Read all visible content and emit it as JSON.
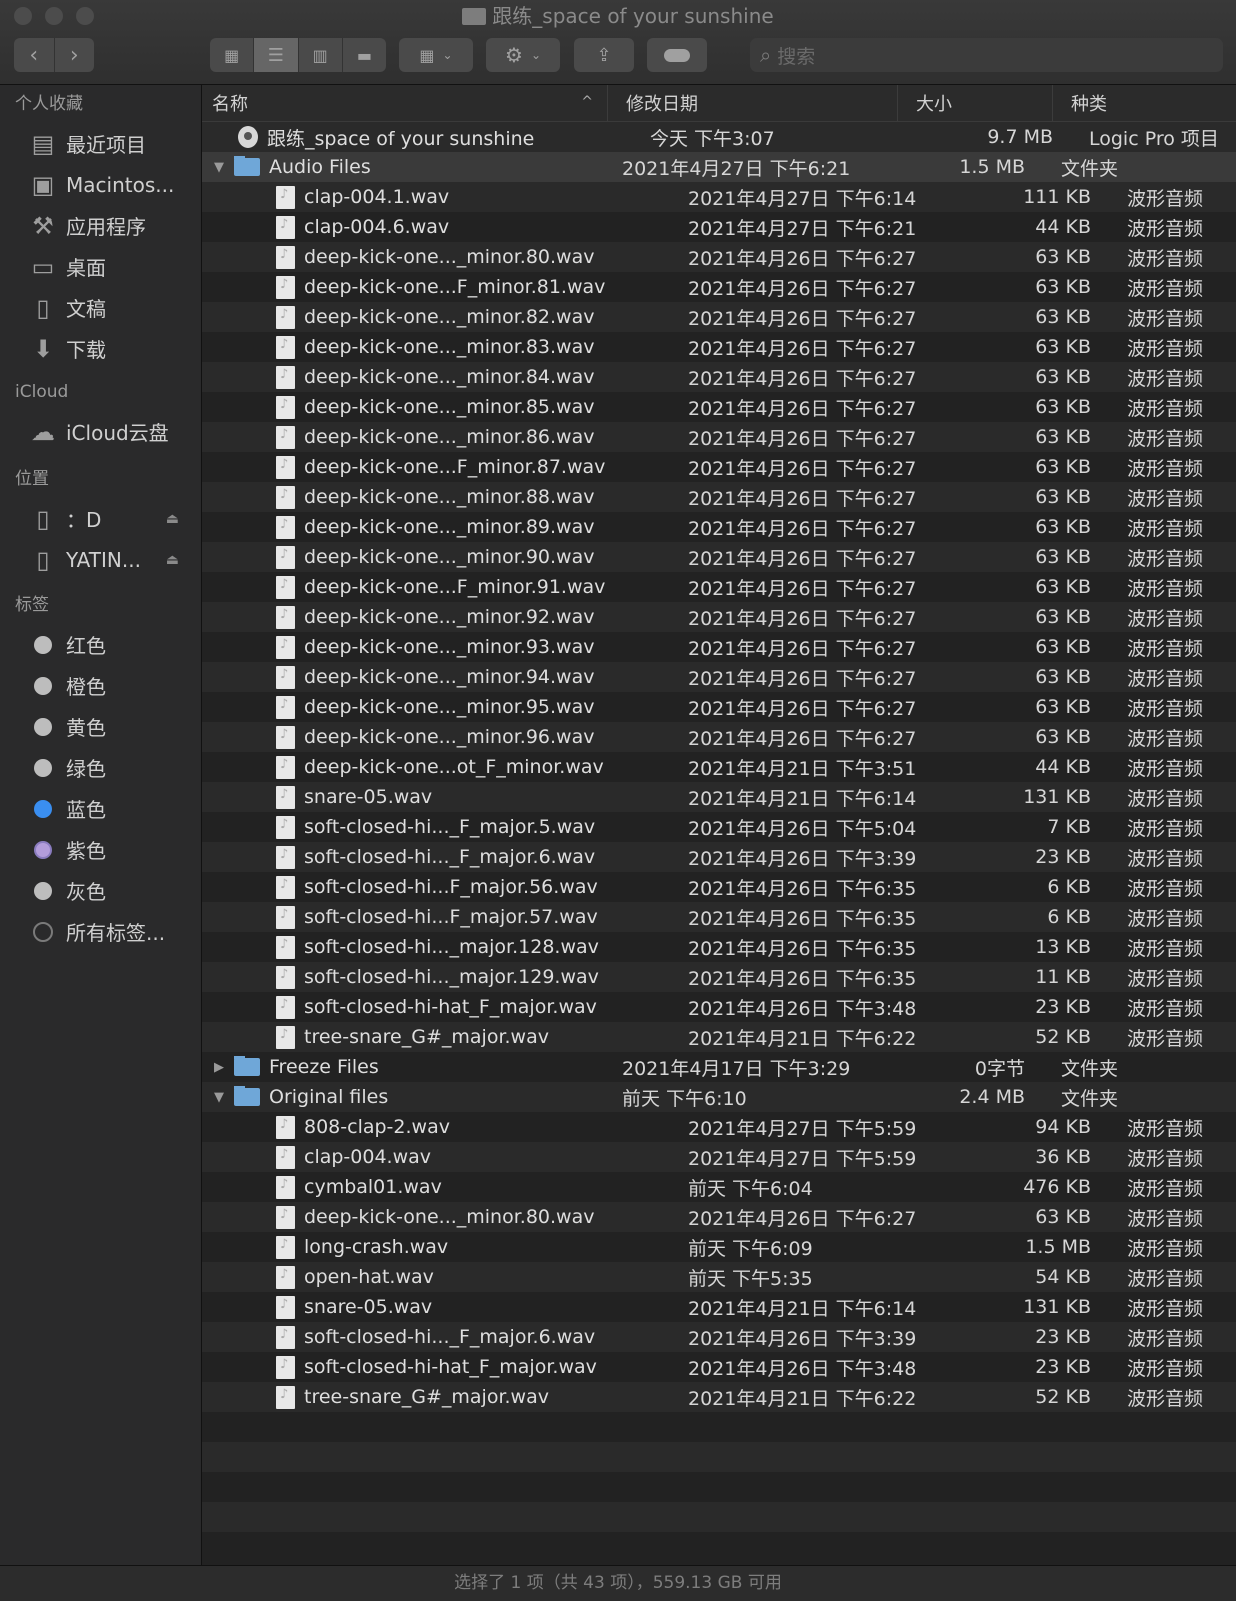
{
  "window": {
    "title": "跟练_space of your sunshine"
  },
  "toolbar": {
    "search_placeholder": "搜索"
  },
  "sidebar": {
    "favorites_header": "个人收藏",
    "favorites": [
      {
        "label": "最近项目",
        "icon": "recents-icon"
      },
      {
        "label": "Macintos...",
        "icon": "hard-drive-icon"
      },
      {
        "label": "应用程序",
        "icon": "applications-icon"
      },
      {
        "label": "桌面",
        "icon": "desktop-icon"
      },
      {
        "label": "文稿",
        "icon": "documents-icon"
      },
      {
        "label": "下载",
        "icon": "downloads-icon"
      }
    ],
    "icloud_header": "iCloud",
    "icloud": [
      {
        "label": "iCloud云盘",
        "icon": "cloud-icon"
      }
    ],
    "locations_header": "位置",
    "locations": [
      {
        "label": "：D",
        "icon": "phone-icon"
      },
      {
        "label": "YATIN...",
        "icon": "phone-icon"
      }
    ],
    "tags_header": "标签",
    "tags": [
      {
        "label": "红色",
        "color": "#bdbdbd"
      },
      {
        "label": "橙色",
        "color": "#bdbdbd"
      },
      {
        "label": "黄色",
        "color": "#bdbdbd"
      },
      {
        "label": "绿色",
        "color": "#bdbdbd"
      },
      {
        "label": "蓝色",
        "color": "#3a8ef0"
      },
      {
        "label": "紫色",
        "color": "#b39ddb"
      },
      {
        "label": "灰色",
        "color": "#bdbdbd"
      },
      {
        "label": "所有标签...",
        "color": "none"
      }
    ]
  },
  "columns": {
    "name": "名称",
    "date": "修改日期",
    "size": "大小",
    "kind": "种类"
  },
  "rows": [
    {
      "name": "跟练_space of your sunshine",
      "date": "今天 下午3:07",
      "size": "9.7 MB",
      "kind": "Logic Pro 项目",
      "type": "logic",
      "level": 0
    },
    {
      "name": "Audio Files",
      "date": "2021年4月27日 下午6:21",
      "size": "1.5 MB",
      "kind": "文件夹",
      "type": "folder",
      "level": 0,
      "expanded": true,
      "selected": true
    },
    {
      "name": "clap-004.1.wav",
      "date": "2021年4月27日 下午6:14",
      "size": "111 KB",
      "kind": "波形音频",
      "type": "audio",
      "level": 1
    },
    {
      "name": "clap-004.6.wav",
      "date": "2021年4月27日 下午6:21",
      "size": "44 KB",
      "kind": "波形音频",
      "type": "audio",
      "level": 1
    },
    {
      "name": "deep-kick-one..._minor.80.wav",
      "date": "2021年4月26日 下午6:27",
      "size": "63 KB",
      "kind": "波形音频",
      "type": "audio",
      "level": 1
    },
    {
      "name": "deep-kick-one...F_minor.81.wav",
      "date": "2021年4月26日 下午6:27",
      "size": "63 KB",
      "kind": "波形音频",
      "type": "audio",
      "level": 1
    },
    {
      "name": "deep-kick-one..._minor.82.wav",
      "date": "2021年4月26日 下午6:27",
      "size": "63 KB",
      "kind": "波形音频",
      "type": "audio",
      "level": 1
    },
    {
      "name": "deep-kick-one..._minor.83.wav",
      "date": "2021年4月26日 下午6:27",
      "size": "63 KB",
      "kind": "波形音频",
      "type": "audio",
      "level": 1
    },
    {
      "name": "deep-kick-one..._minor.84.wav",
      "date": "2021年4月26日 下午6:27",
      "size": "63 KB",
      "kind": "波形音频",
      "type": "audio",
      "level": 1
    },
    {
      "name": "deep-kick-one..._minor.85.wav",
      "date": "2021年4月26日 下午6:27",
      "size": "63 KB",
      "kind": "波形音频",
      "type": "audio",
      "level": 1
    },
    {
      "name": "deep-kick-one..._minor.86.wav",
      "date": "2021年4月26日 下午6:27",
      "size": "63 KB",
      "kind": "波形音频",
      "type": "audio",
      "level": 1
    },
    {
      "name": "deep-kick-one...F_minor.87.wav",
      "date": "2021年4月26日 下午6:27",
      "size": "63 KB",
      "kind": "波形音频",
      "type": "audio",
      "level": 1
    },
    {
      "name": "deep-kick-one..._minor.88.wav",
      "date": "2021年4月26日 下午6:27",
      "size": "63 KB",
      "kind": "波形音频",
      "type": "audio",
      "level": 1
    },
    {
      "name": "deep-kick-one..._minor.89.wav",
      "date": "2021年4月26日 下午6:27",
      "size": "63 KB",
      "kind": "波形音频",
      "type": "audio",
      "level": 1
    },
    {
      "name": "deep-kick-one..._minor.90.wav",
      "date": "2021年4月26日 下午6:27",
      "size": "63 KB",
      "kind": "波形音频",
      "type": "audio",
      "level": 1
    },
    {
      "name": "deep-kick-one...F_minor.91.wav",
      "date": "2021年4月26日 下午6:27",
      "size": "63 KB",
      "kind": "波形音频",
      "type": "audio",
      "level": 1
    },
    {
      "name": "deep-kick-one..._minor.92.wav",
      "date": "2021年4月26日 下午6:27",
      "size": "63 KB",
      "kind": "波形音频",
      "type": "audio",
      "level": 1
    },
    {
      "name": "deep-kick-one..._minor.93.wav",
      "date": "2021年4月26日 下午6:27",
      "size": "63 KB",
      "kind": "波形音频",
      "type": "audio",
      "level": 1
    },
    {
      "name": "deep-kick-one..._minor.94.wav",
      "date": "2021年4月26日 下午6:27",
      "size": "63 KB",
      "kind": "波形音频",
      "type": "audio",
      "level": 1
    },
    {
      "name": "deep-kick-one..._minor.95.wav",
      "date": "2021年4月26日 下午6:27",
      "size": "63 KB",
      "kind": "波形音频",
      "type": "audio",
      "level": 1
    },
    {
      "name": "deep-kick-one..._minor.96.wav",
      "date": "2021年4月26日 下午6:27",
      "size": "63 KB",
      "kind": "波形音频",
      "type": "audio",
      "level": 1
    },
    {
      "name": "deep-kick-one...ot_F_minor.wav",
      "date": "2021年4月21日 下午3:51",
      "size": "44 KB",
      "kind": "波形音频",
      "type": "audio",
      "level": 1
    },
    {
      "name": "snare-05.wav",
      "date": "2021年4月21日 下午6:14",
      "size": "131 KB",
      "kind": "波形音频",
      "type": "audio",
      "level": 1
    },
    {
      "name": "soft-closed-hi..._F_major.5.wav",
      "date": "2021年4月26日 下午5:04",
      "size": "7 KB",
      "kind": "波形音频",
      "type": "audio",
      "level": 1
    },
    {
      "name": "soft-closed-hi..._F_major.6.wav",
      "date": "2021年4月26日 下午3:39",
      "size": "23 KB",
      "kind": "波形音频",
      "type": "audio",
      "level": 1
    },
    {
      "name": "soft-closed-hi...F_major.56.wav",
      "date": "2021年4月26日 下午6:35",
      "size": "6 KB",
      "kind": "波形音频",
      "type": "audio",
      "level": 1
    },
    {
      "name": "soft-closed-hi...F_major.57.wav",
      "date": "2021年4月26日 下午6:35",
      "size": "6 KB",
      "kind": "波形音频",
      "type": "audio",
      "level": 1
    },
    {
      "name": "soft-closed-hi..._major.128.wav",
      "date": "2021年4月26日 下午6:35",
      "size": "13 KB",
      "kind": "波形音频",
      "type": "audio",
      "level": 1
    },
    {
      "name": "soft-closed-hi..._major.129.wav",
      "date": "2021年4月26日 下午6:35",
      "size": "11 KB",
      "kind": "波形音频",
      "type": "audio",
      "level": 1
    },
    {
      "name": "soft-closed-hi-hat_F_major.wav",
      "date": "2021年4月26日 下午3:48",
      "size": "23 KB",
      "kind": "波形音频",
      "type": "audio",
      "level": 1
    },
    {
      "name": "tree-snare_G#_major.wav",
      "date": "2021年4月21日 下午6:22",
      "size": "52 KB",
      "kind": "波形音频",
      "type": "audio",
      "level": 1
    },
    {
      "name": "Freeze Files",
      "date": "2021年4月17日 下午3:29",
      "size": "0字节",
      "kind": "文件夹",
      "type": "folder",
      "level": 0,
      "expanded": false
    },
    {
      "name": "Original files",
      "date": "前天 下午6:10",
      "size": "2.4 MB",
      "kind": "文件夹",
      "type": "folder",
      "level": 0,
      "expanded": true
    },
    {
      "name": "808-clap-2.wav",
      "date": "2021年4月27日 下午5:59",
      "size": "94 KB",
      "kind": "波形音频",
      "type": "audio",
      "level": 1
    },
    {
      "name": "clap-004.wav",
      "date": "2021年4月27日 下午5:59",
      "size": "36 KB",
      "kind": "波形音频",
      "type": "audio",
      "level": 1
    },
    {
      "name": "cymbal01.wav",
      "date": "前天 下午6:04",
      "size": "476 KB",
      "kind": "波形音频",
      "type": "audio",
      "level": 1
    },
    {
      "name": "deep-kick-one..._minor.80.wav",
      "date": "2021年4月26日 下午6:27",
      "size": "63 KB",
      "kind": "波形音频",
      "type": "audio",
      "level": 1
    },
    {
      "name": "long-crash.wav",
      "date": "前天 下午6:09",
      "size": "1.5 MB",
      "kind": "波形音频",
      "type": "audio",
      "level": 1
    },
    {
      "name": "open-hat.wav",
      "date": "前天 下午5:35",
      "size": "54 KB",
      "kind": "波形音频",
      "type": "audio",
      "level": 1
    },
    {
      "name": "snare-05.wav",
      "date": "2021年4月21日 下午6:14",
      "size": "131 KB",
      "kind": "波形音频",
      "type": "audio",
      "level": 1
    },
    {
      "name": "soft-closed-hi..._F_major.6.wav",
      "date": "2021年4月26日 下午3:39",
      "size": "23 KB",
      "kind": "波形音频",
      "type": "audio",
      "level": 1
    },
    {
      "name": "soft-closed-hi-hat_F_major.wav",
      "date": "2021年4月26日 下午3:48",
      "size": "23 KB",
      "kind": "波形音频",
      "type": "audio",
      "level": 1
    },
    {
      "name": "tree-snare_G#_major.wav",
      "date": "2021年4月21日 下午6:22",
      "size": "52 KB",
      "kind": "波形音频",
      "type": "audio",
      "level": 1
    }
  ],
  "status": {
    "text": "选择了 1 项（共 43 项），559.13 GB 可用"
  }
}
